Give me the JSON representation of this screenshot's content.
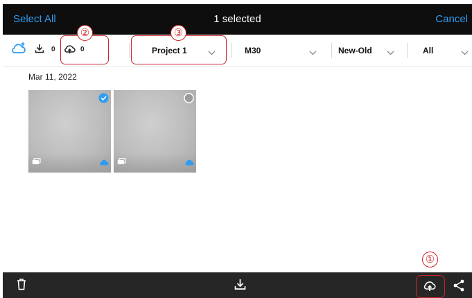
{
  "header": {
    "select_all_label": "Select All",
    "title": "1 selected",
    "cancel_label": "Cancel"
  },
  "filter_bar": {
    "download_count": "0",
    "upload_count": "0",
    "project_filter": "Project 1",
    "drone_filter": "M30",
    "sort_filter": "New-Old",
    "type_filter": "All"
  },
  "media": {
    "date_label": "Mar 11, 2022",
    "items": [
      {
        "selected": true
      },
      {
        "selected": false
      }
    ]
  },
  "annotations": {
    "marker_1": "①",
    "marker_2": "②",
    "marker_3": "③"
  },
  "colors": {
    "accent": "#2f9cf2",
    "topbar_bg": "#0e0e0e",
    "bottombar_bg": "#262626",
    "annotation": "#c9262c"
  }
}
